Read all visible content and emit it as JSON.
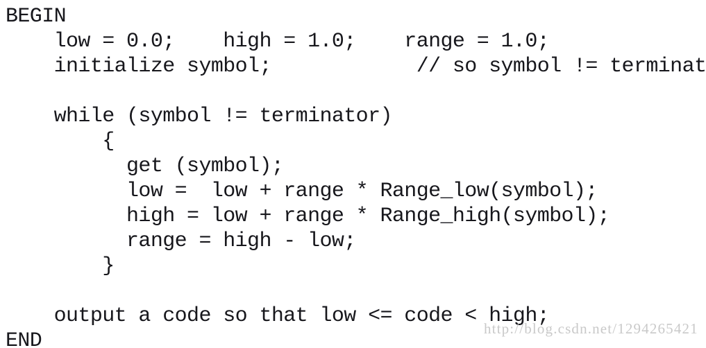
{
  "document": {
    "kind": "pseudocode-listing",
    "background_color": "#ffffff",
    "text_color": "#17171c",
    "code_lines": [
      "BEGIN",
      "    low = 0.0;    high = 1.0;    range = 1.0;",
      "    initialize symbol;            // so symbol != terminator",
      "",
      "    while (symbol != terminator)",
      "        {",
      "          get (symbol);",
      "          low =  low + range * Range_low(symbol);",
      "          high = low + range * Range_high(symbol);",
      "          range = high - low;",
      "        }",
      "",
      "    output a code so that low <= code < high;",
      "END"
    ]
  },
  "watermark": {
    "text": "http://blog.csdn.net/1294265421",
    "color": "#c9c9c9"
  }
}
